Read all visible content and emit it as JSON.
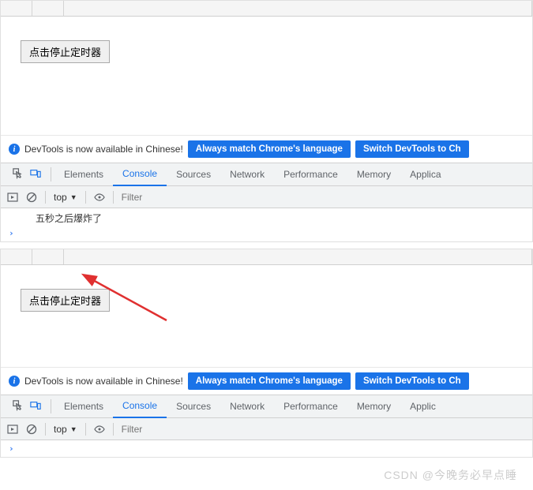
{
  "panel1": {
    "button_label": "点击停止定时器",
    "info_text": "DevTools is now available in Chinese!",
    "match_btn": "Always match Chrome's language",
    "switch_btn": "Switch DevTools to Ch",
    "tabs": {
      "elements": "Elements",
      "console": "Console",
      "sources": "Sources",
      "network": "Network",
      "performance": "Performance",
      "memory": "Memory",
      "application": "Applica"
    },
    "console_toolbar": {
      "context": "top",
      "filter_placeholder": "Filter"
    },
    "log_message": "五秒之后爆炸了"
  },
  "panel2": {
    "button_label": "点击停止定时器",
    "info_text": "DevTools is now available in Chinese!",
    "match_btn": "Always match Chrome's language",
    "switch_btn": "Switch DevTools to Ch",
    "tabs": {
      "elements": "Elements",
      "console": "Console",
      "sources": "Sources",
      "network": "Network",
      "performance": "Performance",
      "memory": "Memory",
      "application": "Applic"
    },
    "console_toolbar": {
      "context": "top",
      "filter_placeholder": "Filter"
    }
  },
  "watermark": "CSDN @今晚务必早点睡"
}
